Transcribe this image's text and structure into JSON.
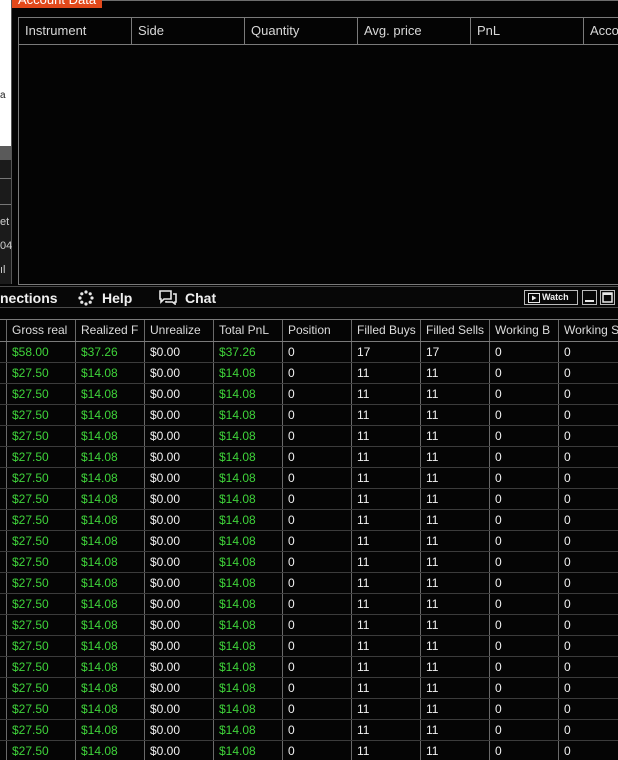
{
  "account_window": {
    "title": "Account Data",
    "columns": [
      "Instrument",
      "Side",
      "Quantity",
      "Avg. price",
      "PnL",
      "Acco"
    ]
  },
  "left_fragments": [
    "a",
    "et",
    "04",
    "ıl"
  ],
  "control_bar": {
    "connections_label": "nections",
    "help_label": "Help",
    "chat_label": "Chat",
    "watch_label": "Watch"
  },
  "positions_grid": {
    "columns": [
      "",
      "Gross real",
      "Realized F",
      "Unrealize",
      "Total PnL",
      "Position",
      "Filled Buys",
      "Filled Sells",
      "Working B",
      "Working S"
    ],
    "rows": [
      [
        "",
        "$58.00",
        "$37.26",
        "$0.00",
        "$37.26",
        "0",
        "17",
        "17",
        "0",
        "0"
      ],
      [
        "",
        "$27.50",
        "$14.08",
        "$0.00",
        "$14.08",
        "0",
        "11",
        "11",
        "0",
        "0"
      ],
      [
        "",
        "$27.50",
        "$14.08",
        "$0.00",
        "$14.08",
        "0",
        "11",
        "11",
        "0",
        "0"
      ],
      [
        "",
        "$27.50",
        "$14.08",
        "$0.00",
        "$14.08",
        "0",
        "11",
        "11",
        "0",
        "0"
      ],
      [
        "",
        "$27.50",
        "$14.08",
        "$0.00",
        "$14.08",
        "0",
        "11",
        "11",
        "0",
        "0"
      ],
      [
        "",
        "$27.50",
        "$14.08",
        "$0.00",
        "$14.08",
        "0",
        "11",
        "11",
        "0",
        "0"
      ],
      [
        "",
        "$27.50",
        "$14.08",
        "$0.00",
        "$14.08",
        "0",
        "11",
        "11",
        "0",
        "0"
      ],
      [
        "",
        "$27.50",
        "$14.08",
        "$0.00",
        "$14.08",
        "0",
        "11",
        "11",
        "0",
        "0"
      ],
      [
        "",
        "$27.50",
        "$14.08",
        "$0.00",
        "$14.08",
        "0",
        "11",
        "11",
        "0",
        "0"
      ],
      [
        "",
        "$27.50",
        "$14.08",
        "$0.00",
        "$14.08",
        "0",
        "11",
        "11",
        "0",
        "0"
      ],
      [
        "",
        "$27.50",
        "$14.08",
        "$0.00",
        "$14.08",
        "0",
        "11",
        "11",
        "0",
        "0"
      ],
      [
        "",
        "$27.50",
        "$14.08",
        "$0.00",
        "$14.08",
        "0",
        "11",
        "11",
        "0",
        "0"
      ],
      [
        "",
        "$27.50",
        "$14.08",
        "$0.00",
        "$14.08",
        "0",
        "11",
        "11",
        "0",
        "0"
      ],
      [
        "",
        "$27.50",
        "$14.08",
        "$0.00",
        "$14.08",
        "0",
        "11",
        "11",
        "0",
        "0"
      ],
      [
        "",
        "$27.50",
        "$14.08",
        "$0.00",
        "$14.08",
        "0",
        "11",
        "11",
        "0",
        "0"
      ],
      [
        "",
        "$27.50",
        "$14.08",
        "$0.00",
        "$14.08",
        "0",
        "11",
        "11",
        "0",
        "0"
      ],
      [
        "",
        "$27.50",
        "$14.08",
        "$0.00",
        "$14.08",
        "0",
        "11",
        "11",
        "0",
        "0"
      ],
      [
        "",
        "$27.50",
        "$14.08",
        "$0.00",
        "$14.08",
        "0",
        "11",
        "11",
        "0",
        "0"
      ],
      [
        "",
        "$27.50",
        "$14.08",
        "$0.00",
        "$14.08",
        "0",
        "11",
        "11",
        "0",
        "0"
      ],
      [
        "",
        "$27.50",
        "$14.08",
        "$0.00",
        "$14.08",
        "0",
        "11",
        "11",
        "0",
        "0"
      ]
    ],
    "green_columns": [
      1,
      2,
      4
    ]
  },
  "colors": {
    "accent": "#e2491b",
    "profit": "#3fd43a",
    "background": "#050505"
  }
}
